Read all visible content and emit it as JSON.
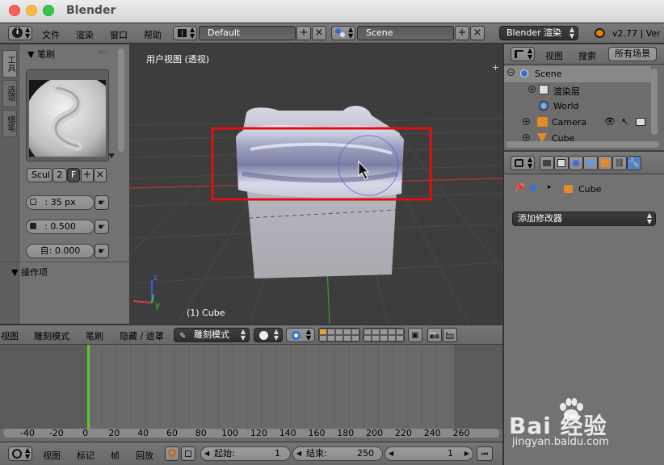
{
  "window": {
    "title": "Blender"
  },
  "info_header": {
    "menus": [
      "文件",
      "渲染",
      "窗口",
      "帮助"
    ],
    "screen_layout": "Default",
    "scene": "Scene",
    "render_engine": "Blender 渲染",
    "version": "v2.77 | Ver"
  },
  "tool_shelf": {
    "tabs": [
      "工具",
      "选项",
      "蜡笔"
    ],
    "brush_panel_title": "笔刷",
    "brush_name": "Scul",
    "brush_users": "2",
    "brush_fake_user": "F",
    "radius": ": 35 px",
    "strength": ": 0.500",
    "autosmooth": "自:   0.000",
    "operator_panel_title": "操作项"
  },
  "viewport": {
    "view_label": "用户视图 (透视)",
    "object_label": "(1) Cube",
    "axis_z": "z",
    "axis_y": "y"
  },
  "outliner": {
    "view_menu": "视图",
    "search_menu": "搜索",
    "filter": "所有场景",
    "items": [
      {
        "label": "Scene"
      },
      {
        "label": "渲染层"
      },
      {
        "label": "World"
      },
      {
        "label": "Camera"
      },
      {
        "label": "Cube"
      }
    ]
  },
  "properties": {
    "breadcrumb_object": "Cube",
    "add_modifier": "添加修改器"
  },
  "sequencer_header": {
    "menus": [
      "视图",
      "雕刻模式",
      "笔刷",
      "隐藏 / 遮罩"
    ],
    "mode": "雕刻模式"
  },
  "timeline": {
    "ticks": [
      "-40",
      "-20",
      "0",
      "20",
      "40",
      "60",
      "80",
      "100",
      "120",
      "140",
      "160",
      "180",
      "200",
      "220",
      "240",
      "260"
    ],
    "footer_menus": [
      "视图",
      "标记",
      "帧",
      "回放"
    ],
    "start_label": "起始:",
    "start_value": "1",
    "end_label": "结束:",
    "end_value": "250",
    "current_frame": "1"
  },
  "watermark": {
    "brand": "Bai  经验",
    "url": "jingyan.baidu.com"
  },
  "colors": {
    "highlight_box": "#e01010",
    "playhead": "#55cc33",
    "grid_red": "#c0392b",
    "grid_green": "#3fa03f"
  }
}
